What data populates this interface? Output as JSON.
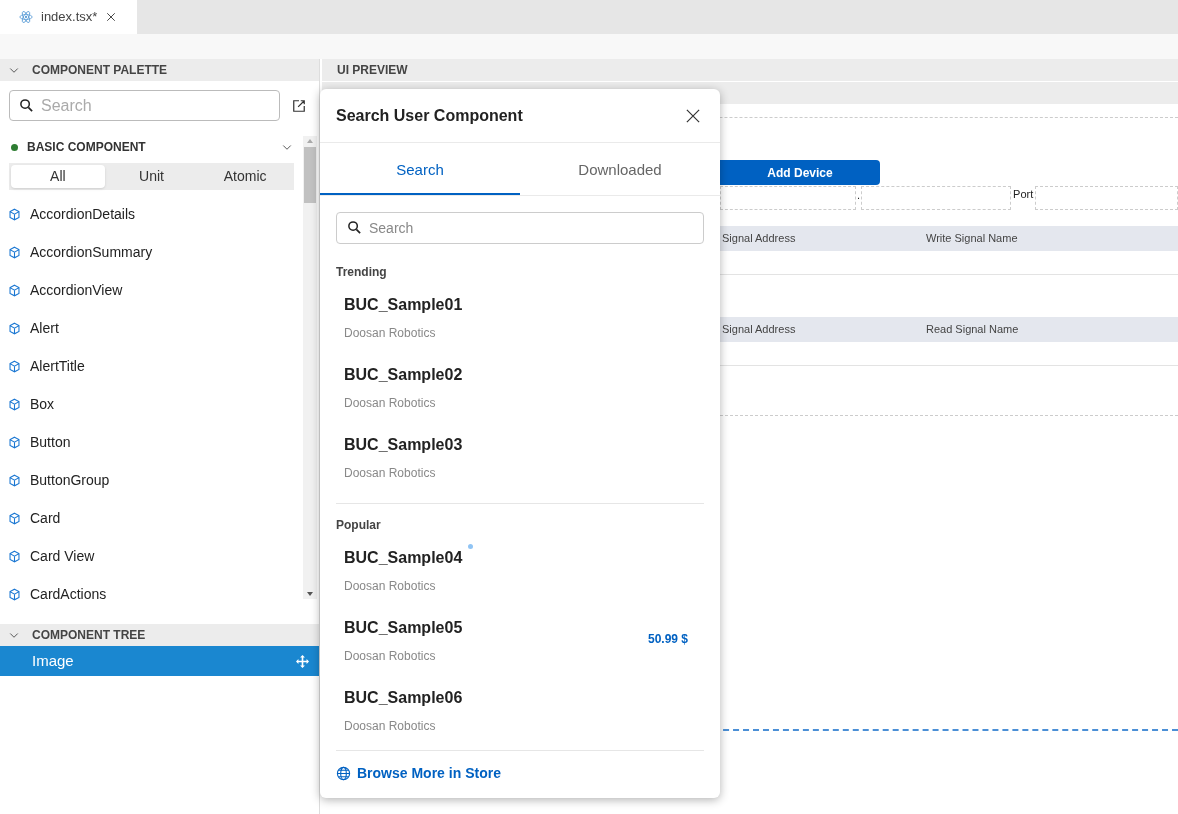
{
  "editor_tabs": [
    {
      "label": "index.tsx*",
      "selected": true
    }
  ],
  "palette": {
    "title": "COMPONENT PALETTE",
    "search": {
      "placeholder": "Search"
    },
    "group_title": "BASIC COMPONENT",
    "filters": [
      {
        "label": "All",
        "selected": true
      },
      {
        "label": "Unit",
        "selected": false
      },
      {
        "label": "Atomic",
        "selected": false
      }
    ],
    "items": [
      "AccordionDetails",
      "AccordionSummary",
      "AccordionView",
      "Alert",
      "AlertTitle",
      "Box",
      "Button",
      "ButtonGroup",
      "Card",
      "Card View",
      "CardActions"
    ]
  },
  "tree": {
    "title": "COMPONENT TREE",
    "items": [
      {
        "label": "Image",
        "selected": true
      }
    ]
  },
  "preview": {
    "title": "UI PREVIEW",
    "add_button": "Add Device",
    "separator": ".",
    "port_label": "Port",
    "tables": [
      {
        "columns": [
          "Signal Address",
          "Write Signal Name"
        ]
      },
      {
        "columns": [
          "Signal Address",
          "Read Signal Name"
        ]
      }
    ]
  },
  "dialog": {
    "title": "Search User Component",
    "tabs": [
      {
        "label": "Search",
        "selected": true
      },
      {
        "label": "Downloaded",
        "selected": false
      }
    ],
    "search": {
      "placeholder": "Search"
    },
    "sections": [
      {
        "title": "Trending",
        "items": [
          {
            "name": "BUC_Sample01",
            "vendor": "Doosan Robotics",
            "new": false
          },
          {
            "name": "BUC_Sample02",
            "vendor": "Doosan Robotics",
            "new": false
          },
          {
            "name": "BUC_Sample03",
            "vendor": "Doosan Robotics",
            "new": false
          }
        ]
      },
      {
        "title": "Popular",
        "items": [
          {
            "name": "BUC_Sample04",
            "vendor": "Doosan Robotics",
            "new": true
          },
          {
            "name": "BUC_Sample05",
            "vendor": "Doosan Robotics",
            "new": false,
            "price": "50.99 $"
          },
          {
            "name": "BUC_Sample06",
            "vendor": "Doosan Robotics",
            "new": false
          }
        ]
      }
    ],
    "footer_link": "Browse More in Store"
  }
}
